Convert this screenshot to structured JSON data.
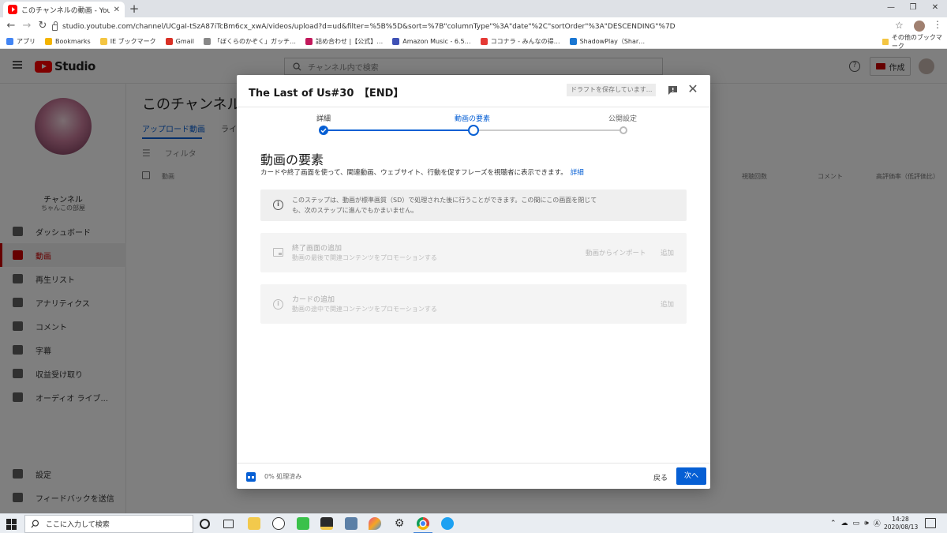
{
  "browser": {
    "tab_title": "このチャンネルの動画 - YouTube Studio",
    "url": "studio.youtube.com/channel/UCgaI-tSzA87iTcBm6cx_xwA/videos/upload?d=ud&filter=%5B%5D&sort=%7B\"columnType\"%3A\"date\"%2C\"sortOrder\"%3A\"DESCENDING\"%7D",
    "bookmarks": [
      {
        "label": "アプリ",
        "color": "#4285f4"
      },
      {
        "label": "Bookmarks",
        "color": "#f4b400"
      },
      {
        "label": "IE ブックマーク",
        "color": "#f4c542"
      },
      {
        "label": "Gmail",
        "color": "#d93025"
      },
      {
        "label": "「ぼくらのかぞく」ガッチ…",
        "color": "#888888"
      },
      {
        "label": "詰め合わせ |【公式】…",
        "color": "#c2185b"
      },
      {
        "label": "Amazon Music - 6.5…",
        "color": "#3f51b5"
      },
      {
        "label": "ココナラ - みんなの得…",
        "color": "#e53935"
      },
      {
        "label": "ShadowPlay（Shar…",
        "color": "#1976d2"
      }
    ],
    "other_bookmarks": "その他のブックマーク"
  },
  "studio": {
    "logo_text": "Studio",
    "search_placeholder": "チャンネル内で検索",
    "create_label": "作成",
    "channel_name": "チャンネル",
    "channel_sub": "ちゃんこの部屋",
    "nav": [
      {
        "label": "ダッシュボード",
        "icon": "dashboard-icon",
        "active": false
      },
      {
        "label": "動画",
        "icon": "video-icon",
        "active": true
      },
      {
        "label": "再生リスト",
        "icon": "playlist-icon",
        "active": false
      },
      {
        "label": "アナリティクス",
        "icon": "analytics-icon",
        "active": false
      },
      {
        "label": "コメント",
        "icon": "comment-icon",
        "active": false
      },
      {
        "label": "字幕",
        "icon": "subtitles-icon",
        "active": false
      },
      {
        "label": "収益受け取り",
        "icon": "dollar-icon",
        "active": false
      },
      {
        "label": "オーディオ ライブ...",
        "icon": "audio-library-icon",
        "active": false
      }
    ],
    "nav_bottom": [
      {
        "label": "設定",
        "icon": "gear-icon"
      },
      {
        "label": "フィードバックを送信",
        "icon": "feedback-icon"
      }
    ],
    "page_title": "このチャンネルの",
    "tabs": [
      "アップロード動画",
      "ライ"
    ],
    "filter_label": "フィルタ",
    "table_headers": [
      "動画",
      "視聴回数",
      "コメント",
      "高評価率（低評価比）"
    ]
  },
  "modal": {
    "title": "The Last of Us#30　【END】",
    "draft_status": "ドラフトを保存しています...",
    "steps": [
      {
        "label": "詳細",
        "state": "done"
      },
      {
        "label": "動画の要素",
        "state": "current"
      },
      {
        "label": "公開設定",
        "state": "todo"
      }
    ],
    "section_title": "動画の要素",
    "section_desc": "カードや終了画面を使って、関連動画、ウェブサイト、行動を促すフレーズを視聴者に表示できます。",
    "section_link": "詳細",
    "info_text": "このステップは、動画が標準画質（SD）で処理された後に行うことができます。この間にこの画面を閉じても、次のステップに進んでもかまいません。",
    "end_screen": {
      "title": "終了画面の追加",
      "subtitle": "動画の最後で関連コンテンツをプロモーションする",
      "import_label": "動画からインポート",
      "add_label": "追加"
    },
    "cards": {
      "title": "カードの追加",
      "subtitle": "動画の途中で関連コンテンツをプロモーションする",
      "add_label": "追加"
    },
    "processing_text": "0% 処理済み",
    "back_label": "戻る",
    "next_label": "次へ"
  },
  "taskbar": {
    "search_placeholder": "ここに入力して検索",
    "time": "14:28",
    "date": "2020/08/13"
  },
  "colors": {
    "accent": "#065fd4",
    "yt_red": "#ff0000"
  }
}
